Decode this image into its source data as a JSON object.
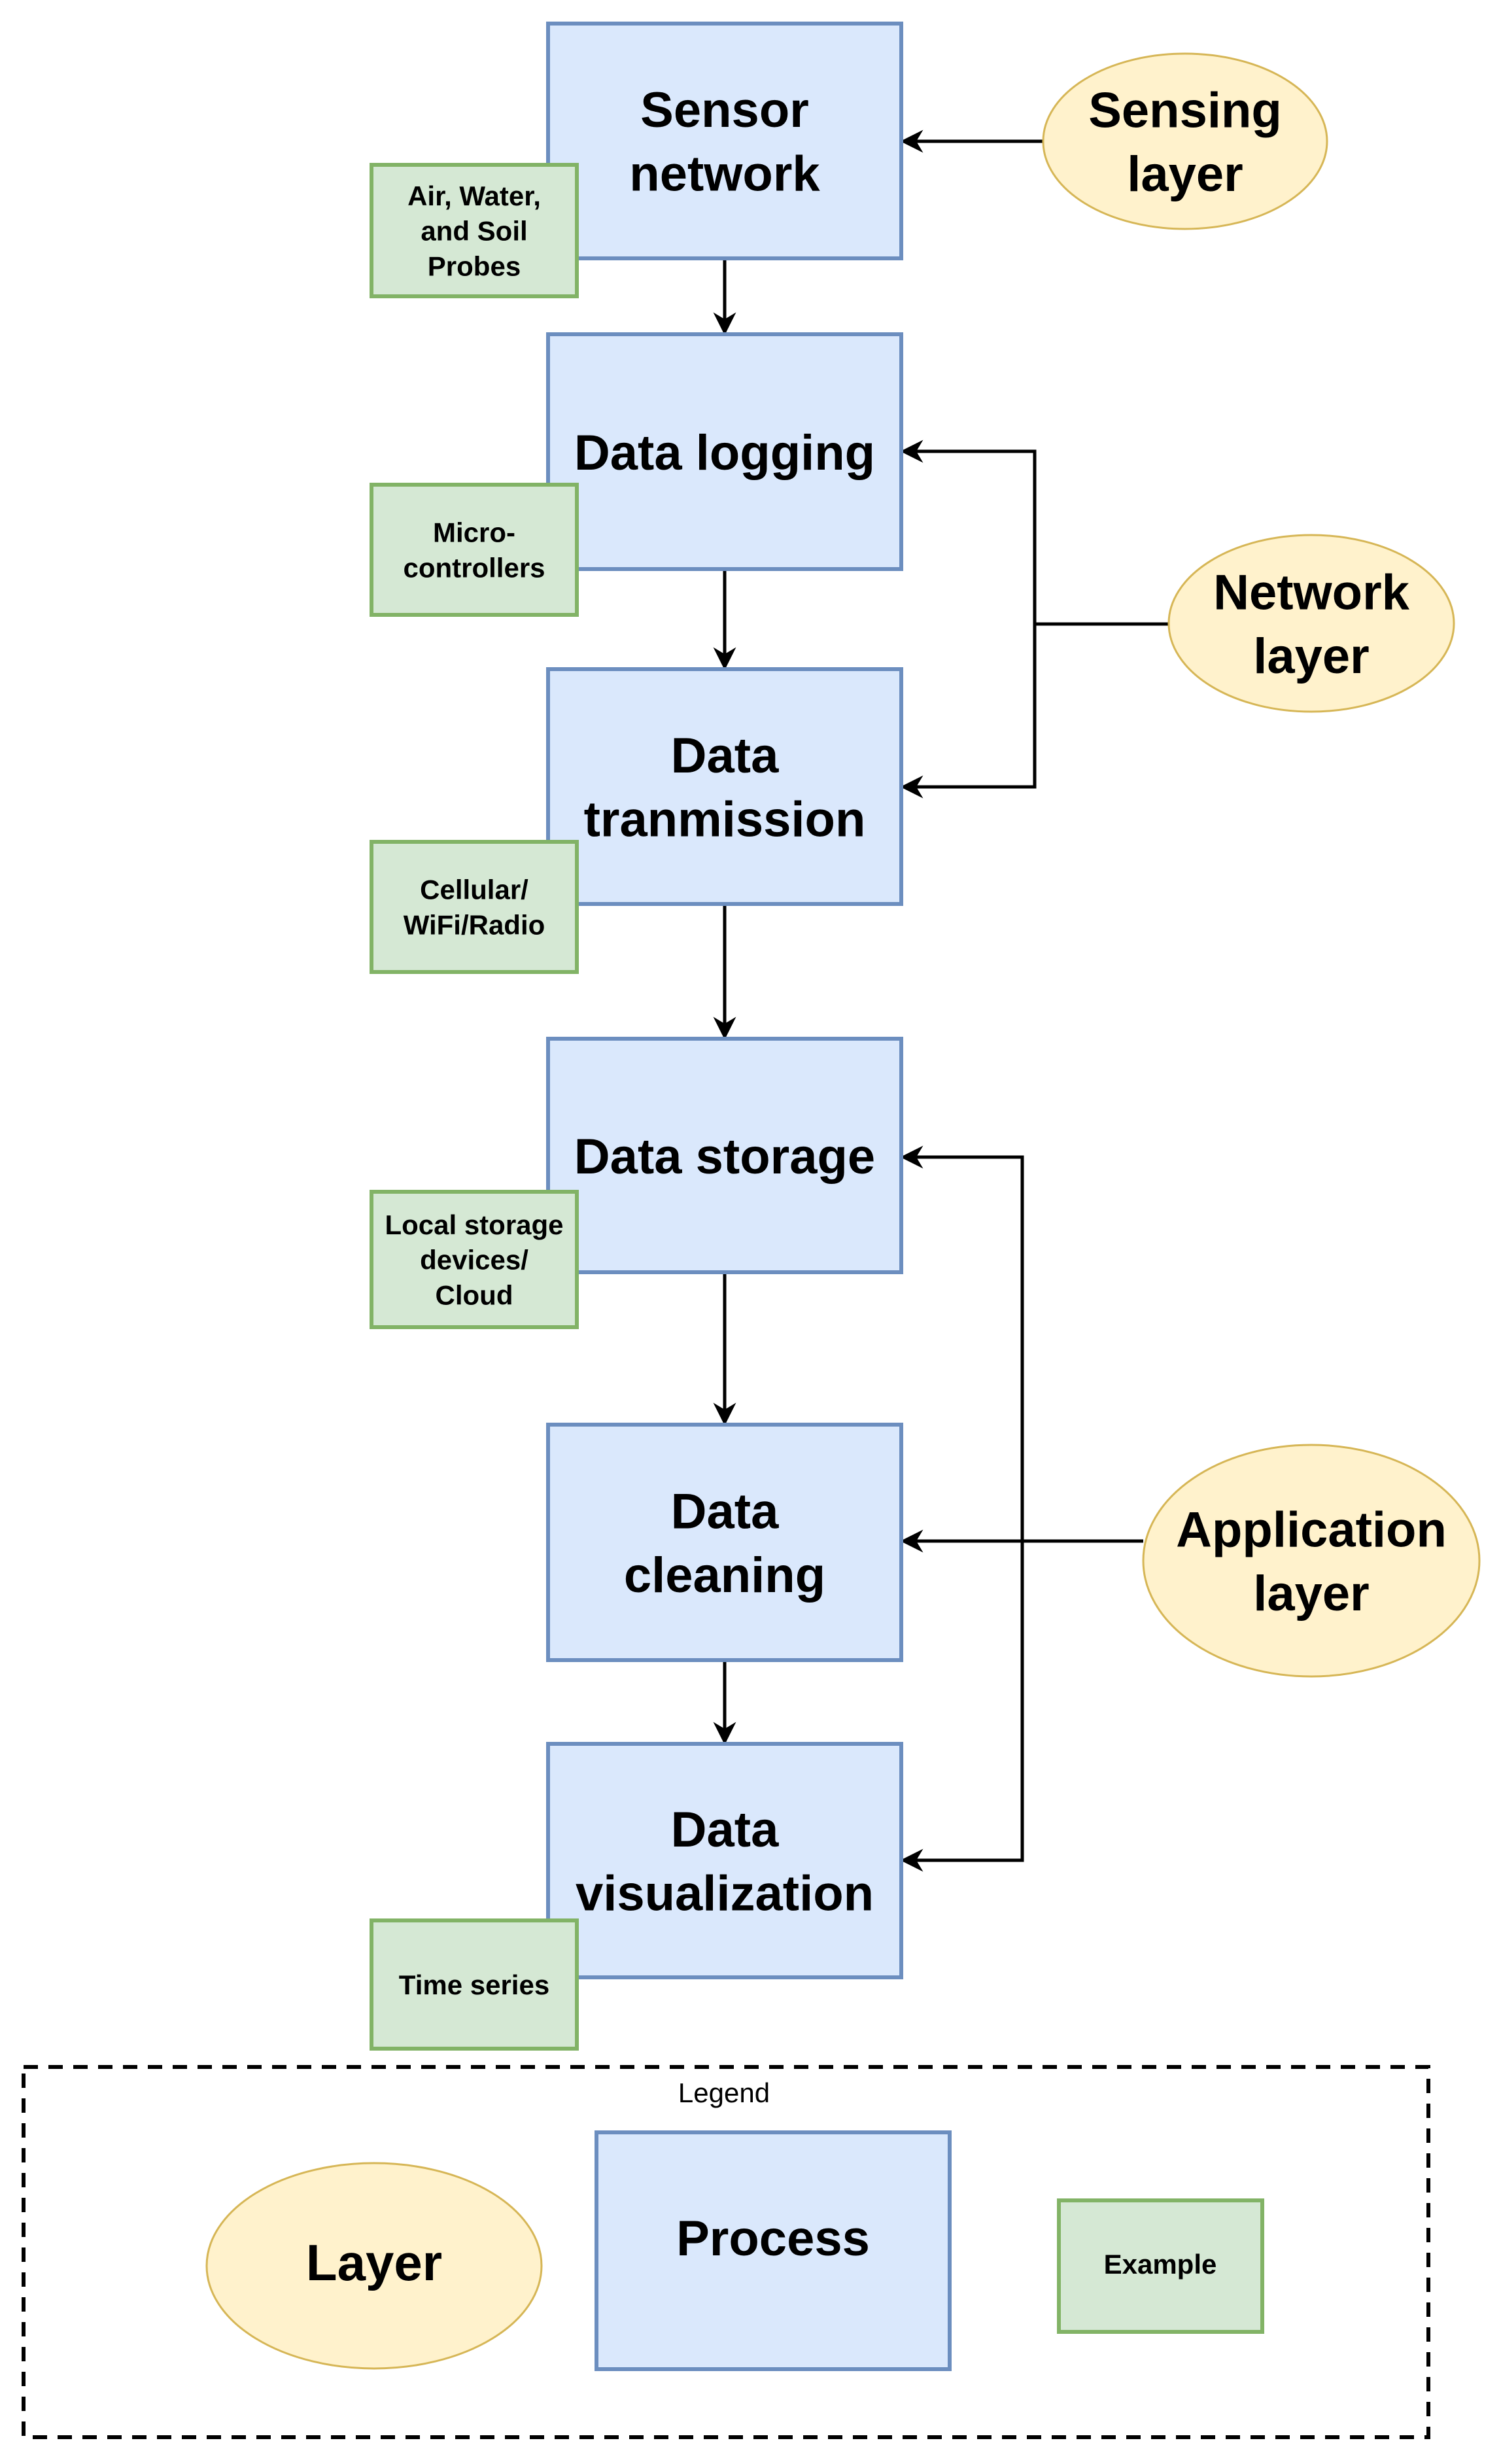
{
  "diagram": {
    "colors": {
      "process_fill": "#DAE8FC",
      "process_stroke": "#6C8EBF",
      "layer_fill": "#FFF2CC",
      "layer_stroke": "#D6B656",
      "example_fill": "#D5E8D4",
      "example_stroke": "#82B366",
      "connector": "#000000"
    },
    "processes": [
      {
        "id": "sensor",
        "label": [
          "Sensor",
          "network"
        ]
      },
      {
        "id": "logging",
        "label": [
          "Data logging"
        ]
      },
      {
        "id": "transmission",
        "label": [
          "Data",
          "tranmission"
        ]
      },
      {
        "id": "storage",
        "label": [
          "Data storage"
        ]
      },
      {
        "id": "cleaning",
        "label": [
          "Data",
          "cleaning"
        ]
      },
      {
        "id": "visualization",
        "label": [
          "Data",
          "visualization"
        ]
      }
    ],
    "examples": [
      {
        "attached_to": "sensor",
        "label": [
          "Air, Water,",
          "and Soil",
          "Probes"
        ]
      },
      {
        "attached_to": "logging",
        "label": [
          "Micro-",
          "controllers"
        ]
      },
      {
        "attached_to": "transmission",
        "label": [
          "Cellular/",
          "WiFi/Radio"
        ]
      },
      {
        "attached_to": "storage",
        "label": [
          "Local storage",
          "devices/",
          "Cloud"
        ]
      },
      {
        "attached_to": "visualization",
        "label": [
          "Time series"
        ]
      }
    ],
    "layers": [
      {
        "id": "sensing",
        "label": [
          "Sensing",
          "layer"
        ],
        "targets": [
          "sensor"
        ]
      },
      {
        "id": "network",
        "label": [
          "Network",
          "layer"
        ],
        "targets": [
          "logging",
          "transmission"
        ]
      },
      {
        "id": "application",
        "label": [
          "Application",
          "layer"
        ],
        "targets": [
          "storage",
          "cleaning",
          "visualization"
        ]
      }
    ],
    "flow": [
      "sensor",
      "logging",
      "transmission",
      "storage",
      "cleaning",
      "visualization"
    ]
  },
  "legend": {
    "title": "Legend",
    "layer_label": "Layer",
    "process_label": "Process",
    "example_label": "Example"
  }
}
